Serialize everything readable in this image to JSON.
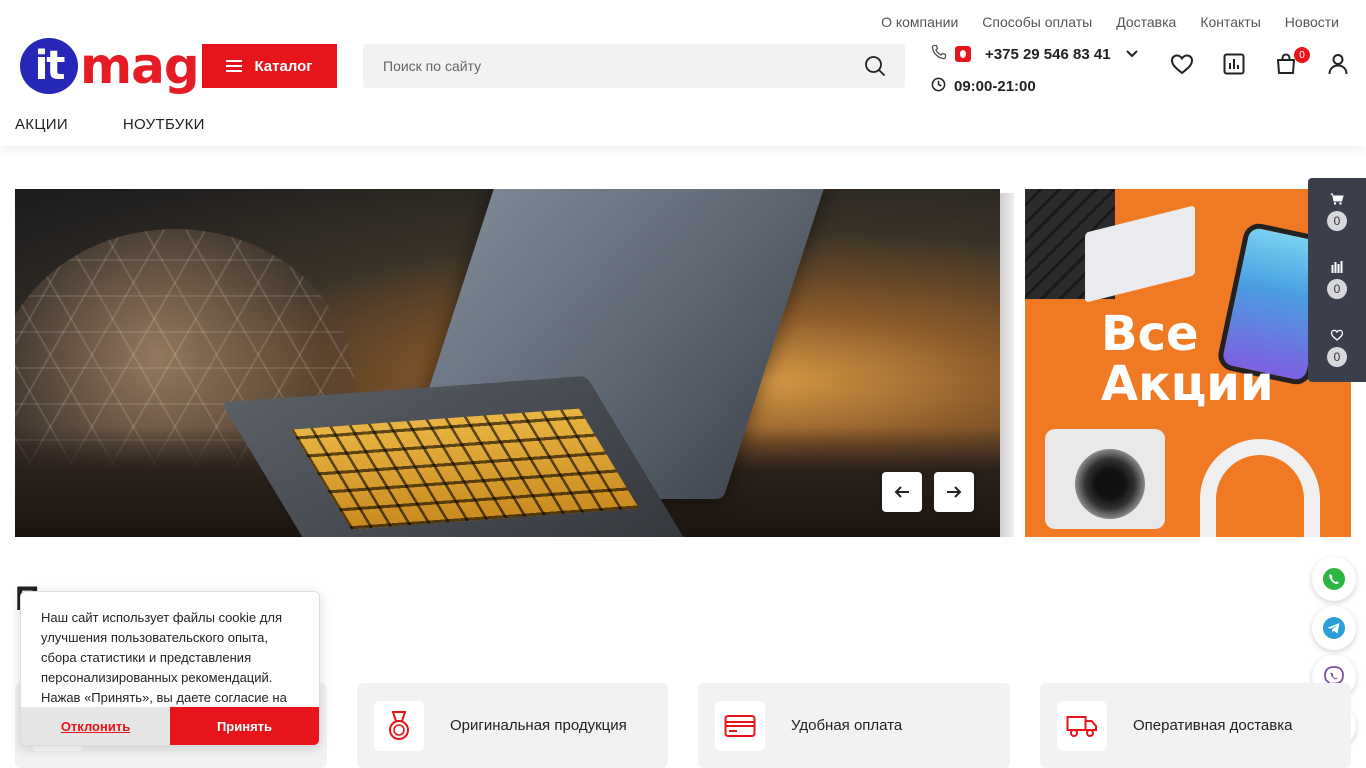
{
  "top_links": [
    "О компании",
    "Способы оплаты",
    "Доставка",
    "Контакты",
    "Новости"
  ],
  "logo": {
    "badge": "it",
    "text": "mag"
  },
  "catalog": {
    "label": "Каталог"
  },
  "search": {
    "placeholder": "Поиск по сайту"
  },
  "contact": {
    "phone": "+375 29 546 83 41",
    "hours": "09:00-21:00"
  },
  "header_icons": {
    "cart_count": "0"
  },
  "nav": [
    "АКЦИИ",
    "НОУТБУКИ"
  ],
  "promo": {
    "line1": "Все",
    "line2": "Акции"
  },
  "side_panel": {
    "cart": "0",
    "compare": "0",
    "favorites": "0"
  },
  "section_heading": "П",
  "features": [
    {
      "label": ""
    },
    {
      "label": "Оригинальная продукция"
    },
    {
      "label": "Удобная оплата"
    },
    {
      "label": "Оперативная доставка"
    }
  ],
  "cookie": {
    "text": "Наш сайт использует файлы cookie для улучшения пользовательского опыта, сбора статистики и представления персонализированных рекомендаций. Нажав «Принять», вы даете согласие на",
    "decline": "Отклонить",
    "accept": "Принять"
  },
  "colors": {
    "brand_red": "#e8141b",
    "brand_blue": "#2626b8",
    "promo_orange": "#f07a24",
    "panel": "#3a3f4b"
  }
}
